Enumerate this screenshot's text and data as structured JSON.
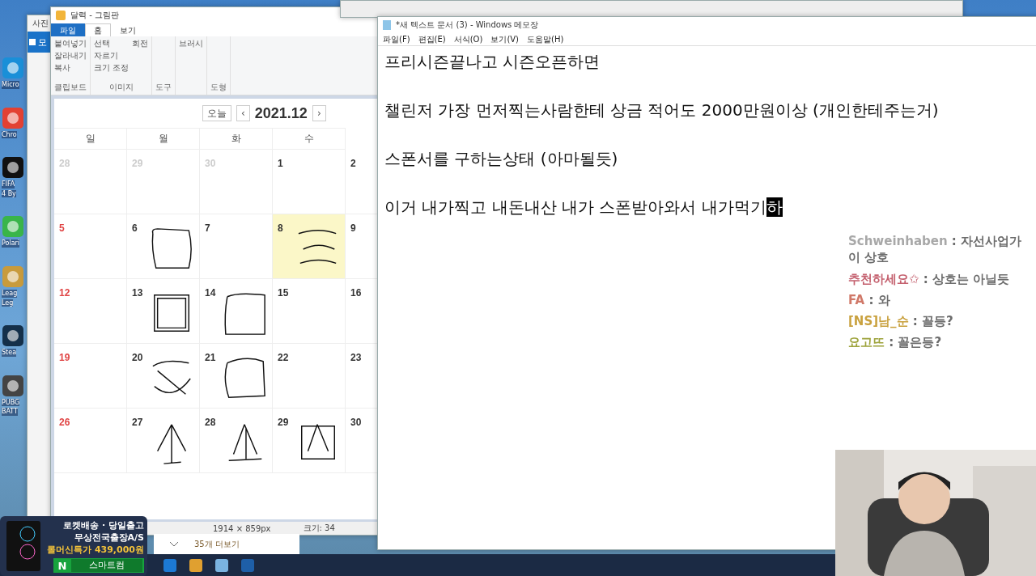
{
  "desktop_icons": [
    {
      "lines": [
        "Micro"
      ]
    },
    {
      "lines": [
        "Chro"
      ]
    },
    {
      "lines": [
        "FIFA",
        "4 By"
      ]
    },
    {
      "lines": [
        "Polari"
      ]
    },
    {
      "lines": [
        "Leag",
        "Leg"
      ]
    },
    {
      "lines": [
        "Stea"
      ]
    },
    {
      "lines": [
        "PUBG",
        "BATT"
      ]
    }
  ],
  "back_window": {
    "title": "사진",
    "item": "모"
  },
  "paint": {
    "title": "달력 - 그림판",
    "tabs": [
      {
        "label": "파일",
        "kind": "file",
        "selected": false
      },
      {
        "label": "홈",
        "kind": "tab",
        "selected": true
      },
      {
        "label": "보기",
        "kind": "tab",
        "selected": false
      }
    ],
    "groups": [
      {
        "label": "클립보드",
        "buttons": [
          "붙여넣기",
          "잘라내기",
          "복사"
        ]
      },
      {
        "label": "이미지",
        "buttons": [
          "선택",
          "자르기",
          "크기 조정",
          "회전"
        ]
      },
      {
        "label": "도구"
      },
      {
        "buttons": [
          "브러시"
        ]
      },
      {
        "label": "도형"
      }
    ],
    "status": [
      "1914 × 859px",
      "크기: 34"
    ]
  },
  "calendar": {
    "today_button": "오늘",
    "prev": "‹",
    "month": "2021.12",
    "next": "›",
    "weekdays": [
      "일",
      "월",
      "화",
      "수"
    ],
    "weeks": [
      [
        {
          "day": "28",
          "kind": "other"
        },
        {
          "day": "29",
          "kind": "other"
        },
        {
          "day": "30",
          "kind": "other"
        },
        {
          "day": "1",
          "kind": "normal"
        },
        {
          "day": "2",
          "kind": "normal"
        }
      ],
      [
        {
          "day": "5",
          "kind": "sunday"
        },
        {
          "day": "6",
          "kind": "normal"
        },
        {
          "day": "7",
          "kind": "normal"
        },
        {
          "day": "8",
          "kind": "highlight"
        },
        {
          "day": "9",
          "kind": "normal"
        }
      ],
      [
        {
          "day": "12",
          "kind": "sunday"
        },
        {
          "day": "13",
          "kind": "normal"
        },
        {
          "day": "14",
          "kind": "normal"
        },
        {
          "day": "15",
          "kind": "normal"
        },
        {
          "day": "16",
          "kind": "normal"
        }
      ],
      [
        {
          "day": "19",
          "kind": "sunday"
        },
        {
          "day": "20",
          "kind": "normal"
        },
        {
          "day": "21",
          "kind": "normal"
        },
        {
          "day": "22",
          "kind": "normal"
        },
        {
          "day": "23",
          "kind": "normal"
        }
      ],
      [
        {
          "day": "26",
          "kind": "sunday"
        },
        {
          "day": "27",
          "kind": "normal"
        },
        {
          "day": "28",
          "kind": "normal"
        },
        {
          "day": "29",
          "kind": "normal"
        },
        {
          "day": "30",
          "kind": "normal"
        }
      ]
    ]
  },
  "notepad": {
    "title": "*새 텍스트 문서 (3) - Windows 메모장",
    "menu": [
      "파일(F)",
      "편집(E)",
      "서식(O)",
      "보기(V)",
      "도움말(H)"
    ],
    "lines": [
      {
        "kind": "text",
        "text": "프리시즌끝나고 시즌오픈하면"
      },
      {
        "kind": "blank"
      },
      {
        "kind": "text",
        "text": "챌린저 가장 먼저찍는사람한테 상금 적어도 2000만원이상 (개인한테주는거)"
      },
      {
        "kind": "blank"
      },
      {
        "kind": "text",
        "text": "스폰서를 구하는상태 (아마될듯)"
      },
      {
        "kind": "blank"
      },
      {
        "kind": "text",
        "text": "이거 내가찍고 내돈내산 내가 스폰받아와서 내가먹기",
        "selection": "하"
      }
    ]
  },
  "chat": [
    {
      "user": "Schweinhaben",
      "separator": ":",
      "text": "자선사업가 이 상호",
      "color": "#a8a8a8"
    },
    {
      "user": "추천하세요✩",
      "separator": ":",
      "text": "상호는 아닐듯",
      "color": "#c4606e"
    },
    {
      "user": "FA",
      "separator": ":",
      "text": "와",
      "color": "#d07868"
    },
    {
      "user": "[NS]남_순",
      "separator": ":",
      "text": "꼴등?",
      "color": "#c9a13e"
    },
    {
      "user": "요고뜨",
      "separator": ":",
      "text": "꼴은등?",
      "color": "#9ea33c"
    }
  ],
  "more_bar": {
    "label": "35개 더보기"
  },
  "ad": {
    "lines": [
      "로켓배송 · 당일출고",
      "무상전국출장A/S",
      "롤머신특가 439,000원"
    ],
    "badge": "N",
    "button": "스마트컴"
  }
}
